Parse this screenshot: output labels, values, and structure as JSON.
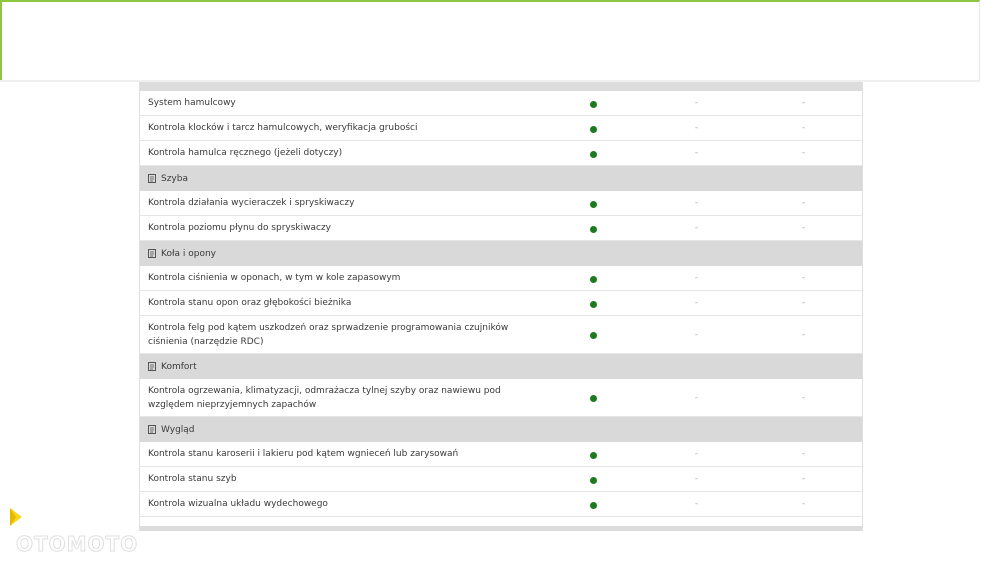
{
  "logo": {
    "text": "OTOMOTO",
    "accent_color": "#f9d71c"
  },
  "colors": {
    "dot": "#1e7a1e",
    "section_bg": "#d9d9d9",
    "accent": "#8dc63f"
  },
  "dash": "-",
  "rows": [
    {
      "type": "item",
      "label": "System hamulcowy",
      "dot": true
    },
    {
      "type": "item",
      "label": "Kontrola klocków i tarcz hamulcowych, weryfikacja grubości",
      "dot": true
    },
    {
      "type": "item",
      "label": "Kontrola hamulca ręcznego (jeżeli dotyczy)",
      "dot": true
    },
    {
      "type": "section",
      "label": "Szyba",
      "icon": "document-icon"
    },
    {
      "type": "item",
      "label": "Kontrola działania wycieraczek i spryskiwaczy",
      "dot": true
    },
    {
      "type": "item",
      "label": "Kontrola poziomu płynu do spryskiwaczy",
      "dot": true
    },
    {
      "type": "section",
      "label": "Koła i opony",
      "icon": "document-icon"
    },
    {
      "type": "item",
      "label": "Kontrola ciśnienia w oponach, w tym w kole zapasowym",
      "dot": true
    },
    {
      "type": "item",
      "label": "Kontrola stanu opon oraz głębokości bieżnika",
      "dot": true
    },
    {
      "type": "item",
      "tall": true,
      "label": "Kontrola felg pod kątem uszkodzeń oraz sprwadzenie programowania czujników ciśnienia (narzędzie RDC)",
      "dot": true
    },
    {
      "type": "section",
      "label": "Komfort",
      "icon": "document-icon"
    },
    {
      "type": "item",
      "tall": true,
      "label": "Kontrola ogrzewania, klimatyzacji, odmrażacza tylnej szyby oraz nawiewu pod względem nieprzyjemnych zapachów",
      "dot": true
    },
    {
      "type": "section",
      "label": "Wygląd",
      "icon": "document-icon"
    },
    {
      "type": "item",
      "label": "Kontrola stanu karoserii i lakieru pod kątem wgnieceń lub zarysowań",
      "dot": true
    },
    {
      "type": "item",
      "label": "Kontrola stanu szyb",
      "dot": true
    },
    {
      "type": "item",
      "label": "Kontrola wizualna układu wydechowego",
      "dot": true
    }
  ]
}
